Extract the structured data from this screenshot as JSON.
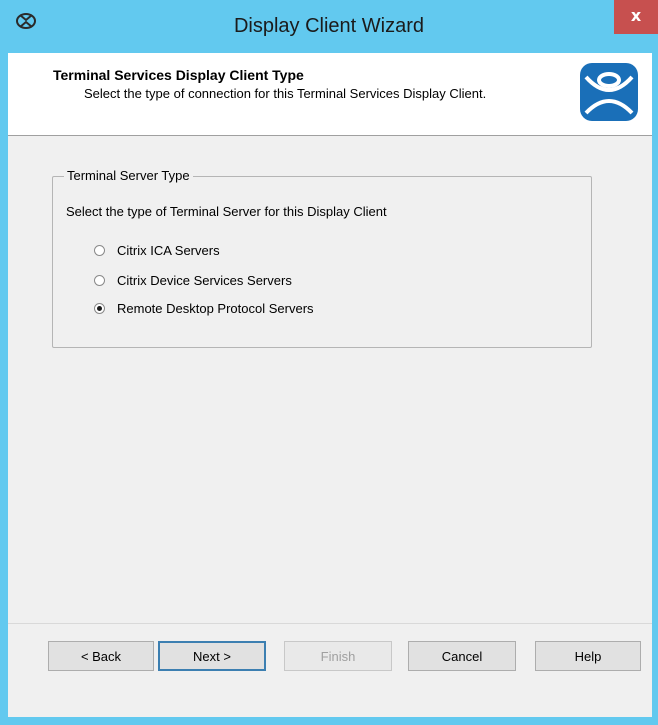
{
  "window": {
    "title": "Display Client Wizard",
    "close_label": "x"
  },
  "header": {
    "title": "Terminal Services Display Client Type",
    "description": "Select the type of connection for this Terminal Services Display Client."
  },
  "group": {
    "legend": "Terminal Server Type",
    "prompt": "Select the type of Terminal Server for this Display Client",
    "options": [
      {
        "label": "Citrix ICA Servers",
        "checked": false
      },
      {
        "label": "Citrix Device Services Servers",
        "checked": false
      },
      {
        "label": "Remote Desktop Protocol Servers",
        "checked": true
      }
    ]
  },
  "buttons": {
    "back": "< Back",
    "next": "Next >",
    "finish": "Finish",
    "cancel": "Cancel",
    "help": "Help"
  },
  "colors": {
    "frame": "#62c9ef",
    "close": "#c7504f",
    "logo_blue": "#1a6fb8"
  }
}
